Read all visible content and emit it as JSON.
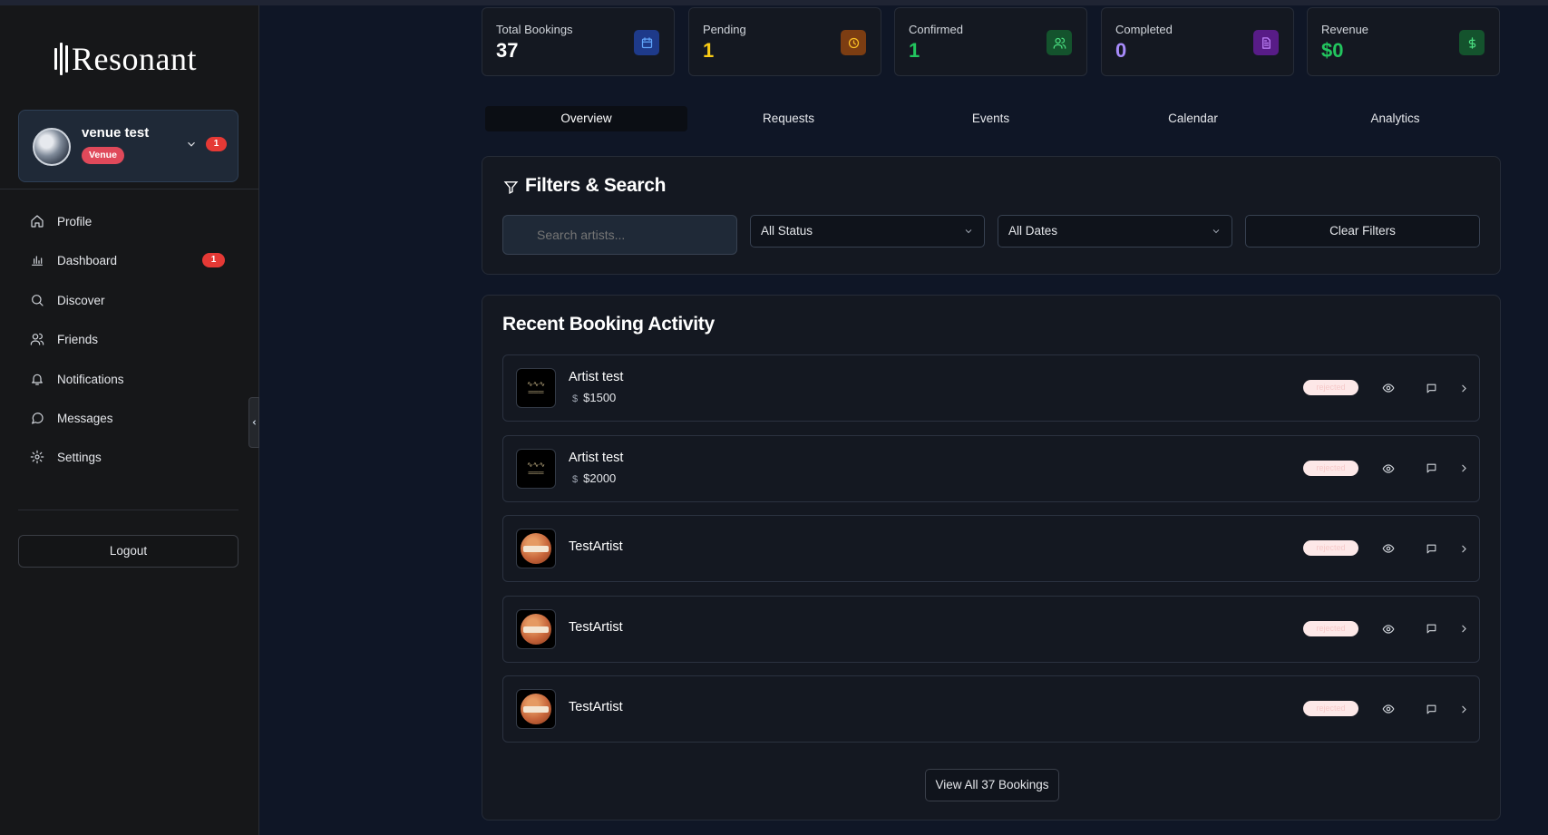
{
  "app": {
    "name": "Resonant"
  },
  "user": {
    "name": "venue test",
    "role": "Venue",
    "notifications": "1"
  },
  "nav": [
    {
      "label": "Profile",
      "icon": "home-icon"
    },
    {
      "label": "Dashboard",
      "icon": "bar-chart-icon",
      "badge": "1"
    },
    {
      "label": "Discover",
      "icon": "search-icon"
    },
    {
      "label": "Friends",
      "icon": "users-icon"
    },
    {
      "label": "Notifications",
      "icon": "bell-icon"
    },
    {
      "label": "Messages",
      "icon": "message-icon"
    },
    {
      "label": "Settings",
      "icon": "gear-icon"
    }
  ],
  "logout_label": "Logout",
  "stats": [
    {
      "label": "Total Bookings",
      "value": "37",
      "color": "#ffffff",
      "icon": "calendar-icon",
      "icon_bg": "#1e3a8a",
      "icon_color": "#60a5fa"
    },
    {
      "label": "Pending",
      "value": "1",
      "color": "#facc15",
      "icon": "clock-icon",
      "icon_bg": "#7c3d12",
      "icon_color": "#fbbf24"
    },
    {
      "label": "Confirmed",
      "value": "1",
      "color": "#22c55e",
      "icon": "users-icon",
      "icon_bg": "#14532d",
      "icon_color": "#4ade80"
    },
    {
      "label": "Completed",
      "value": "0",
      "color": "#a78bfa",
      "icon": "document-icon",
      "icon_bg": "#581c87",
      "icon_color": "#c084fc"
    },
    {
      "label": "Revenue",
      "value": "$0",
      "color": "#22c55e",
      "icon": "dollar-icon",
      "icon_bg": "#14532d",
      "icon_color": "#4ade80"
    }
  ],
  "tabs": [
    "Overview",
    "Requests",
    "Events",
    "Calendar",
    "Analytics"
  ],
  "active_tab": "Overview",
  "filters": {
    "title": "Filters & Search",
    "search_placeholder": "Search artists...",
    "status": "All Status",
    "dates": "All Dates",
    "clear": "Clear Filters"
  },
  "activity": {
    "title": "Recent Booking Activity",
    "items": [
      {
        "name": "Artist test",
        "price": "$1500",
        "thumb": "logo",
        "status": "rejected"
      },
      {
        "name": "Artist test",
        "price": "$2000",
        "thumb": "logo",
        "status": "rejected"
      },
      {
        "name": "TestArtist",
        "price": "",
        "thumb": "basketball",
        "status": "rejected"
      },
      {
        "name": "TestArtist",
        "price": "",
        "thumb": "basketball",
        "status": "rejected"
      },
      {
        "name": "TestArtist",
        "price": "",
        "thumb": "basketball",
        "status": "rejected"
      }
    ],
    "view_all": "View All 37 Bookings"
  }
}
